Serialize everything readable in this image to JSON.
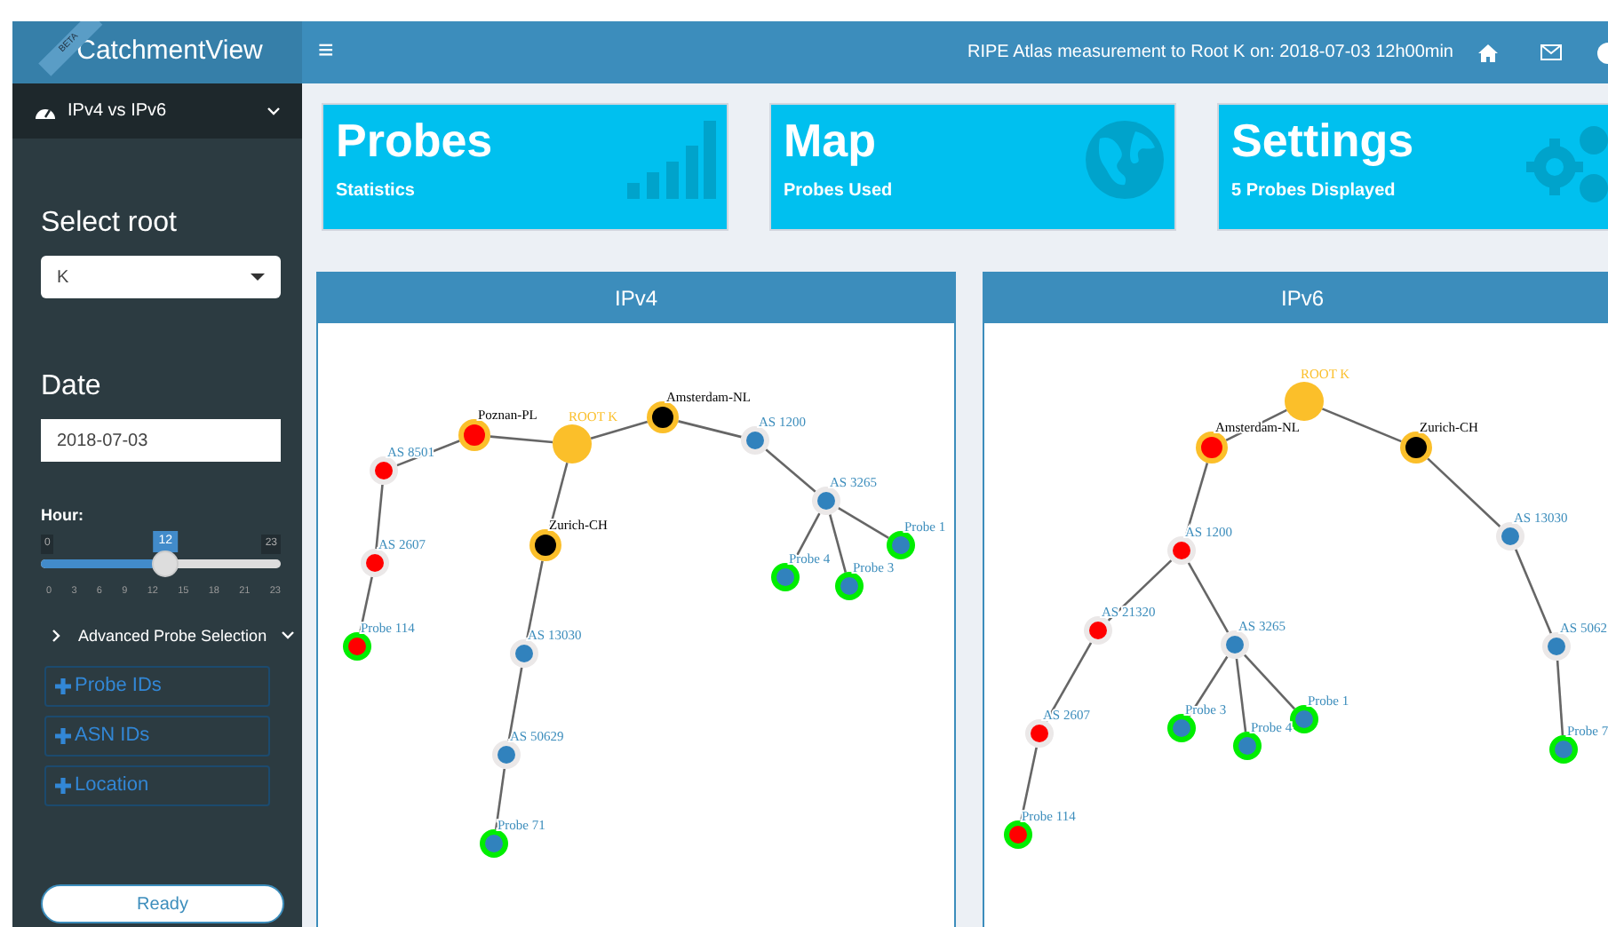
{
  "logo": {
    "badge": "BETA",
    "title": "CatchmentView"
  },
  "header": {
    "menu_icon": "≡",
    "title": "RIPE Atlas measurement to Root K on: 2018-07-03 12h00min"
  },
  "sidebar": {
    "menu_item": {
      "label": "IPv4 vs IPv6",
      "expanded": true
    },
    "root_select": {
      "label": "Select root",
      "value": "K"
    },
    "date": {
      "label": "Date",
      "value": "2018-07-03"
    },
    "hour": {
      "label": "Hour:",
      "min": "0",
      "max": "23",
      "value": "12",
      "level": 0.52,
      "ticks": [
        "0",
        "3",
        "6",
        "9",
        "12",
        "15",
        "18",
        "21",
        "23"
      ]
    },
    "advanced": {
      "label": "Advanced Probe Selection",
      "expanded": true
    },
    "buttons": [
      {
        "label": "Probe IDs"
      },
      {
        "label": "ASN IDs"
      },
      {
        "label": "Location"
      }
    ],
    "status_button": "Ready"
  },
  "info_boxes": [
    {
      "title": "Probes",
      "subtitle": "Statistics",
      "kind": "bars"
    },
    {
      "title": "Map",
      "subtitle": "Probes Used",
      "kind": "globe"
    },
    {
      "title": "Settings",
      "subtitle": "5 Probes Displayed",
      "kind": "gears"
    }
  ],
  "panels": [
    {
      "title": "IPv4",
      "tree": {
        "label": "ROOT K",
        "kind": "root",
        "children": [
          {
            "label": "Poznan-PL",
            "kind": "city",
            "color": "#ff0000",
            "children": [
              {
                "label": "AS 8501",
                "kind": "as",
                "color": "#ff0000",
                "children": [
                  {
                    "label": "AS 2607",
                    "kind": "as",
                    "color": "#ff0000",
                    "children": [
                      {
                        "label": "Probe 114",
                        "kind": "probe",
                        "color": "#ff0000"
                      }
                    ]
                  }
                ]
              }
            ]
          },
          {
            "label": "Zurich-CH",
            "kind": "city",
            "color": "#000000",
            "children": [
              {
                "label": "AS 13030",
                "kind": "as",
                "color": "#3182bd",
                "children": [
                  {
                    "label": "AS 50629",
                    "kind": "as",
                    "color": "#3182bd",
                    "children": [
                      {
                        "label": "Probe 71",
                        "kind": "probe",
                        "color": "#3182bd"
                      }
                    ]
                  }
                ]
              }
            ]
          },
          {
            "label": "Amsterdam-NL",
            "kind": "city",
            "color": "#000000",
            "children": [
              {
                "label": "AS 1200",
                "kind": "as",
                "color": "#3182bd",
                "children": [
                  {
                    "label": "AS 3265",
                    "kind": "as",
                    "color": "#3182bd",
                    "children": [
                      {
                        "label": "Probe 4",
                        "kind": "probe",
                        "color": "#3182bd"
                      },
                      {
                        "label": "Probe 3",
                        "kind": "probe",
                        "color": "#3182bd"
                      },
                      {
                        "label": "Probe 1",
                        "kind": "probe",
                        "color": "#3182bd"
                      }
                    ]
                  }
                ]
              }
            ]
          }
        ]
      }
    },
    {
      "title": "IPv6",
      "tree": {
        "label": "ROOT K",
        "kind": "root",
        "children": [
          {
            "label": "Amsterdam-NL",
            "kind": "city",
            "color": "#ff0000",
            "children": [
              {
                "label": "AS 1200",
                "kind": "as",
                "color": "#ff0000",
                "children": [
                  {
                    "label": "AS 21320",
                    "kind": "as",
                    "color": "#ff0000",
                    "children": [
                      {
                        "label": "AS 2607",
                        "kind": "as",
                        "color": "#ff0000",
                        "children": [
                          {
                            "label": "Probe 114",
                            "kind": "probe",
                            "color": "#ff0000"
                          }
                        ]
                      }
                    ]
                  },
                  {
                    "label": "AS 3265",
                    "kind": "as",
                    "color": "#3182bd",
                    "children": [
                      {
                        "label": "Probe 3",
                        "kind": "probe",
                        "color": "#3182bd"
                      },
                      {
                        "label": "Probe 4",
                        "kind": "probe",
                        "color": "#3182bd"
                      },
                      {
                        "label": "Probe 1",
                        "kind": "probe",
                        "color": "#3182bd"
                      }
                    ]
                  }
                ]
              }
            ]
          },
          {
            "label": "Zurich-CH",
            "kind": "city",
            "color": "#000000",
            "children": [
              {
                "label": "AS 13030",
                "kind": "as",
                "color": "#3182bd",
                "children": [
                  {
                    "label": "AS 5062",
                    "kind": "as",
                    "color": "#3182bd",
                    "children": [
                      {
                        "label": "Probe 7",
                        "kind": "probe",
                        "color": "#3182bd"
                      }
                    ]
                  }
                ]
              }
            ]
          }
        ]
      }
    }
  ]
}
